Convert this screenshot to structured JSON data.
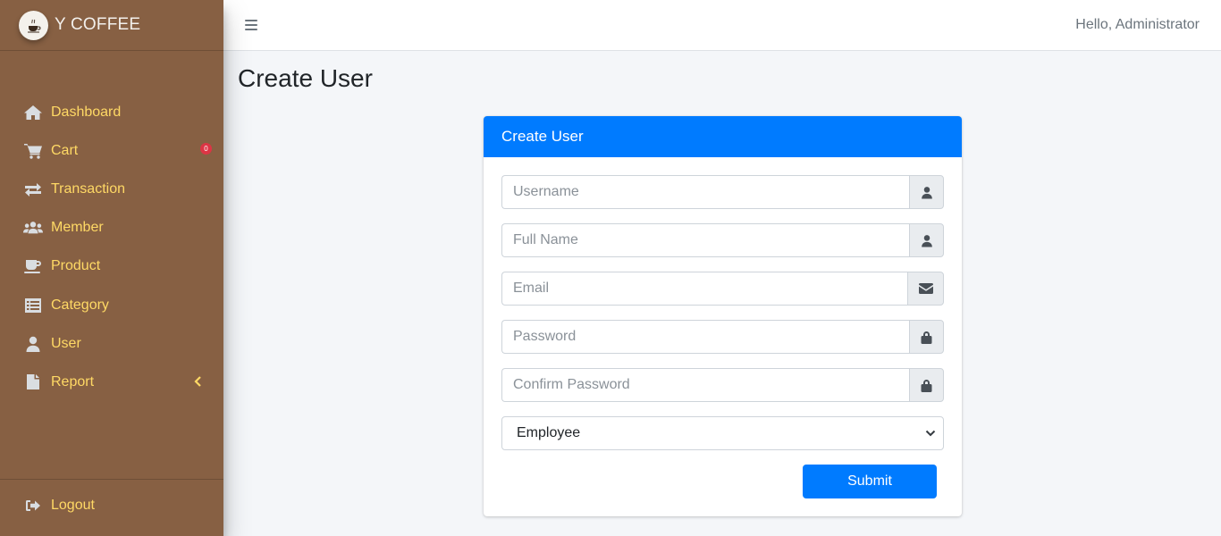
{
  "brand": {
    "name": "Y COFFEE"
  },
  "sidebar": {
    "items": [
      {
        "label": "Dashboard"
      },
      {
        "label": "Cart",
        "badge": "0"
      },
      {
        "label": "Transaction"
      },
      {
        "label": "Member"
      },
      {
        "label": "Product"
      },
      {
        "label": "Category"
      },
      {
        "label": "User"
      },
      {
        "label": "Report"
      }
    ],
    "logout": "Logout"
  },
  "topbar": {
    "greeting": "Hello, Administrator"
  },
  "page": {
    "title": "Create User"
  },
  "form": {
    "header": "Create User",
    "username": {
      "placeholder": "Username",
      "icon": "user-icon"
    },
    "fullname": {
      "placeholder": "Full Name",
      "icon": "user-icon"
    },
    "email": {
      "placeholder": "Email",
      "icon": "envelope-icon"
    },
    "password": {
      "placeholder": "Password",
      "icon": "lock-icon"
    },
    "confirm_password": {
      "placeholder": "Confirm Password",
      "icon": "lock-icon"
    },
    "role": {
      "selected": "Employee"
    },
    "submit_label": "Submit"
  },
  "colors": {
    "sidebar_bg": "#876043",
    "sidebar_text": "#ffd965",
    "primary": "#007bff",
    "badge": "#dc3545"
  }
}
